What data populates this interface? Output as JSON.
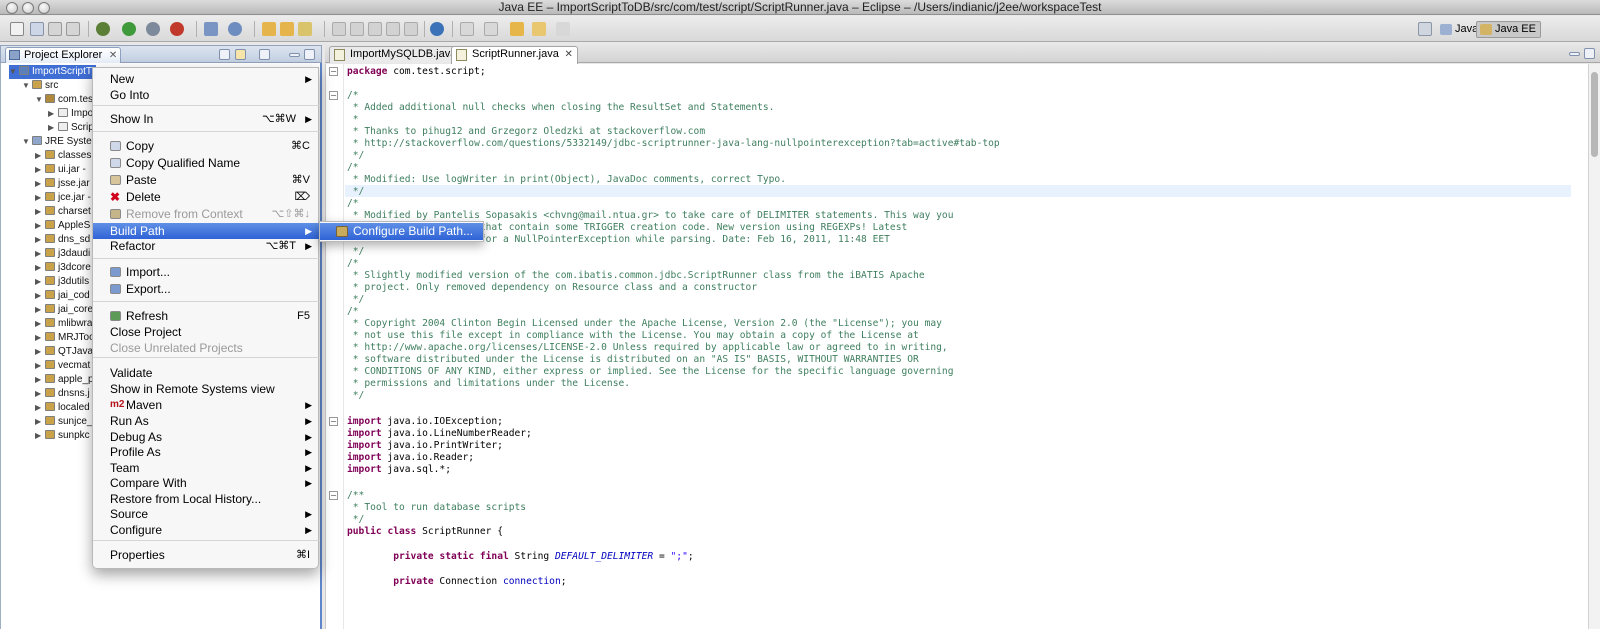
{
  "window": {
    "title": "Java EE – ImportScriptToDB/src/com/test/script/ScriptRunner.java – Eclipse – /Users/indianic/j2ee/workspaceTest"
  },
  "perspectives": [
    {
      "label": "Java"
    },
    {
      "label": "Java EE"
    }
  ],
  "project_explorer": {
    "tab_label": "Project Explorer",
    "tree": [
      "ImportScriptT",
      "src",
      "com.tes",
      "Impo",
      "Scrip",
      "JRE System",
      "classes",
      "ui.jar -",
      "jsse.jar",
      "jce.jar -",
      "charset",
      "AppleS",
      "dns_sd",
      "j3daudi",
      "j3dcore",
      "j3dutils",
      "jai_cod",
      "jai_core",
      "mlibwra",
      "MRJToo",
      "QTJava.",
      "vecmat",
      "apple_p",
      "dnsns.j",
      "localed",
      "sunjce_",
      "sunpkc"
    ]
  },
  "editor": {
    "tabs": [
      {
        "label": "ImportMySQLDB.java"
      },
      {
        "label": "ScriptRunner.java"
      }
    ],
    "lines": [
      "package com.test.script;",
      "",
      "/*",
      " * Added additional null checks when closing the ResultSet and Statements.",
      " *",
      " * Thanks to pihug12 and Grzegorz Oledzki at stackoverflow.com",
      " * http://stackoverflow.com/questions/5332149/jdbc-scriptrunner-java-lang-nullpointerexception?tab=active#tab-top",
      " */",
      "/*",
      " * Modified: Use logWriter in print(Object), JavaDoc comments, correct Typo.",
      " */",
      "/*",
      " * Modified by Pantelis Sopasakis <chvng@mail.ntua.gr> to take care of DELIMITER statements. This way you",
      " * can execute scripts that contain some TRIGGER creation code. New version using REGEXPs! Latest",
      " * modification: Cater for a NullPointerException while parsing. Date: Feb 16, 2011, 11:48 EET",
      " */",
      "/*",
      " * Slightly modified version of the com.ibatis.common.jdbc.ScriptRunner class from the iBATIS Apache",
      " * project. Only removed dependency on Resource class and a constructor",
      " */",
      "/*",
      " * Copyright 2004 Clinton Begin Licensed under the Apache License, Version 2.0 (the \"License\"); you may",
      " * not use this file except in compliance with the License. You may obtain a copy of the License at",
      " * http://www.apache.org/licenses/LICENSE-2.0 Unless required by applicable law or agreed to in writing,",
      " * software distributed under the License is distributed on an \"AS IS\" BASIS, WITHOUT WARRANTIES OR",
      " * CONDITIONS OF ANY KIND, either express or implied. See the License for the specific language governing",
      " * permissions and limitations under the License.",
      " */",
      "",
      "import java.io.IOException;",
      "import java.io.LineNumberReader;",
      "import java.io.PrintWriter;",
      "import java.io.Reader;",
      "import java.sql.*;",
      "",
      "/**",
      " * Tool to run database scripts",
      " */",
      "public class ScriptRunner {",
      "",
      "        private static final String DEFAULT_DELIMITER = \";\";",
      "",
      "        private Connection connection;"
    ]
  },
  "context_menu": {
    "items": [
      {
        "label": "New",
        "shortcut": "",
        "submenu": true
      },
      {
        "label": "Go Into",
        "shortcut": "",
        "submenu": false
      },
      {
        "label": "Show In",
        "shortcut": "⌥⌘W",
        "submenu": true
      },
      {
        "label": "Copy",
        "shortcut": "⌘C",
        "icon": "copy-icon"
      },
      {
        "label": "Copy Qualified Name",
        "shortcut": "",
        "icon": "copy-qualified-icon"
      },
      {
        "label": "Paste",
        "shortcut": "⌘V",
        "icon": "paste-icon"
      },
      {
        "label": "Delete",
        "shortcut": "⌦",
        "icon": "delete-icon"
      },
      {
        "label": "Remove from Context",
        "shortcut": "⌥⇧⌘↓",
        "icon": "remove-context-icon",
        "disabled": true
      },
      {
        "label": "Build Path",
        "shortcut": "",
        "submenu": true,
        "selected": true
      },
      {
        "label": "Refactor",
        "shortcut": "⌥⌘T",
        "submenu": true
      },
      {
        "label": "Import...",
        "shortcut": "",
        "icon": "import-icon"
      },
      {
        "label": "Export...",
        "shortcut": "",
        "icon": "export-icon"
      },
      {
        "label": "Refresh",
        "shortcut": "F5",
        "icon": "refresh-icon"
      },
      {
        "label": "Close Project",
        "shortcut": ""
      },
      {
        "label": "Close Unrelated Projects",
        "shortcut": "",
        "disabled": true
      },
      {
        "label": "Validate",
        "shortcut": ""
      },
      {
        "label": "Show in Remote Systems view",
        "shortcut": ""
      },
      {
        "label": "Maven",
        "shortcut": "",
        "submenu": true,
        "badge": "m2"
      },
      {
        "label": "Run As",
        "submenu": true
      },
      {
        "label": "Debug As",
        "submenu": true
      },
      {
        "label": "Profile As",
        "submenu": true
      },
      {
        "label": "Team",
        "submenu": true
      },
      {
        "label": "Compare With",
        "submenu": true
      },
      {
        "label": "Restore from Local History...",
        "submenu": false
      },
      {
        "label": "Source",
        "submenu": true
      },
      {
        "label": "Configure",
        "submenu": true
      },
      {
        "label": "Properties",
        "shortcut": "⌘I"
      }
    ],
    "submenu_arrow": "▶"
  },
  "build_path_submenu": {
    "items": [
      {
        "label": "Configure Build Path..."
      }
    ]
  }
}
